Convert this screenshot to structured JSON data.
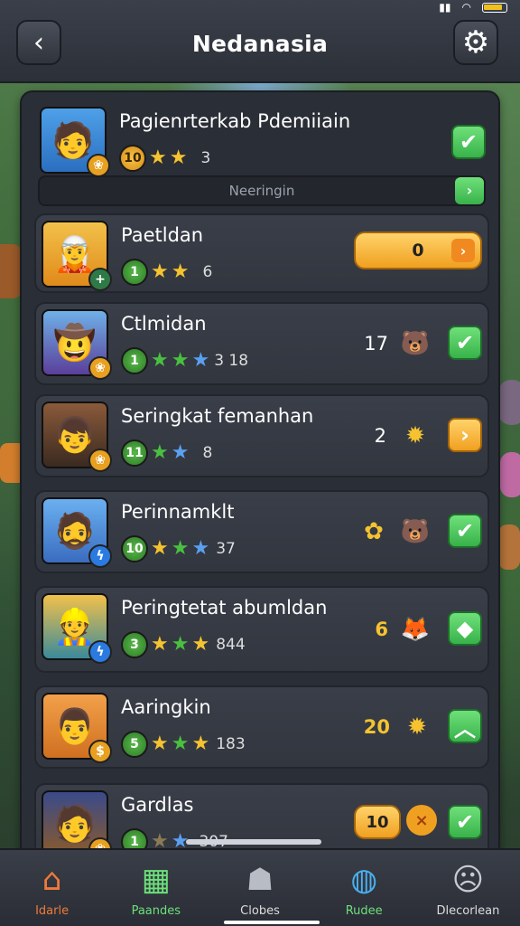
{
  "header": {
    "title": "Nedanasia",
    "back_icon": "chevron-left-icon",
    "settings_icon": "gear-icon"
  },
  "colors": {
    "accent_green": "#38b24a",
    "accent_orange": "#f0a020",
    "panel": "#2a2e36"
  },
  "rows": [
    {
      "name": "Pagienrterkab Pdemiiain",
      "level": "10",
      "value": "3",
      "action": "check"
    },
    {
      "name": "Paetldan",
      "level": "1",
      "value": "6",
      "button_value": "0"
    },
    {
      "name": "Ctlmidan",
      "level": "1",
      "value": "3 18",
      "count": "17",
      "action": "check"
    },
    {
      "name": "Seringkat femanhan",
      "level": "11",
      "value": "8",
      "count": "2",
      "action": "orange-arrow"
    },
    {
      "name": "Perinnamklt",
      "level": "10",
      "value": "37",
      "action": "check"
    },
    {
      "name": "Peringtetat abumldan",
      "level": "3",
      "value": "844",
      "count": "6",
      "action": "diamond"
    },
    {
      "name": "Aaringkin",
      "level": "5",
      "value": "183",
      "count": "20",
      "action": "up"
    },
    {
      "name": "Gardlas",
      "level": "1",
      "value": "307",
      "button_value": "10",
      "action": "check"
    }
  ],
  "subbar": {
    "label": "Neeringin"
  },
  "nav": [
    {
      "label": "Idarle",
      "icon": "home-icon"
    },
    {
      "label": "Paandes",
      "icon": "shop-icon"
    },
    {
      "label": "Clobes",
      "icon": "clothes-icon"
    },
    {
      "label": "Rudee",
      "icon": "globe-icon"
    },
    {
      "label": "Dlecorlean",
      "icon": "chat-icon"
    }
  ]
}
